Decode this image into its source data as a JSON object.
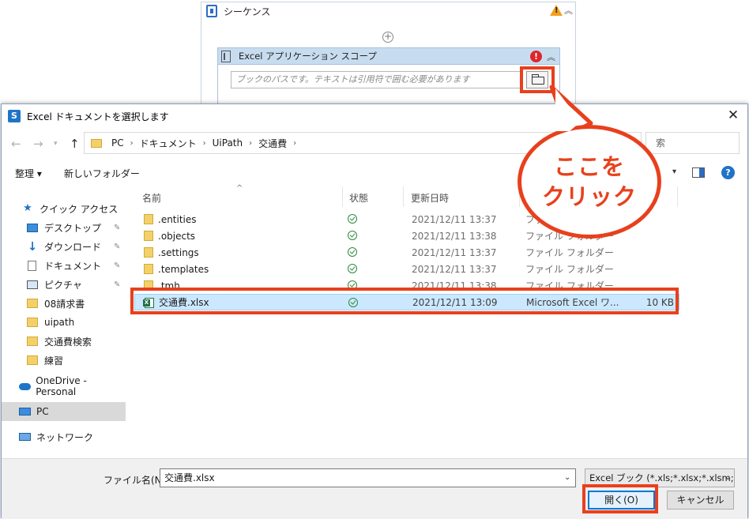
{
  "sequence": {
    "title": "シーケンス",
    "warning_icon": "warning-icon",
    "collapse_icon": "chevron-up-double-icon"
  },
  "scope": {
    "title": "Excel アプリケーション スコープ",
    "placeholder": "ブックのパスです。テキストは引用符で囲む必要があります",
    "error_icon": "error-icon",
    "browse_icon": "folder-icon"
  },
  "dialog": {
    "title": "Excel ドキュメントを選択します",
    "breadcrumbs": [
      "PC",
      "ドキュメント",
      "UiPath",
      "交通費"
    ],
    "search_placeholder": "索",
    "toolbar": {
      "organize": "整理 ▾",
      "new_folder": "新しいフォルダー"
    },
    "nav": [
      {
        "label": "クイック アクセス",
        "icon": "star-icon"
      },
      {
        "label": "デスクトップ",
        "icon": "desktop-icon",
        "pinned": true
      },
      {
        "label": "ダウンロード",
        "icon": "download-icon",
        "pinned": true
      },
      {
        "label": "ドキュメント",
        "icon": "documents-icon",
        "pinned": true
      },
      {
        "label": "ピクチャ",
        "icon": "pictures-icon",
        "pinned": true
      },
      {
        "label": "08請求書",
        "icon": "folder-icon"
      },
      {
        "label": "uipath",
        "icon": "folder-icon"
      },
      {
        "label": "交通費検索",
        "icon": "folder-icon"
      },
      {
        "label": "練習",
        "icon": "folder-icon"
      },
      {
        "label": "OneDrive - Personal",
        "icon": "cloud-icon"
      },
      {
        "label": "PC",
        "icon": "pc-icon"
      },
      {
        "label": "ネットワーク",
        "icon": "network-icon"
      }
    ],
    "columns": {
      "name": "名前",
      "status": "状態",
      "modified": "更新日時"
    },
    "files": [
      {
        "name": ".entities",
        "date": "2021/12/11 13:37",
        "type": "ファイル フォルダー",
        "size": ""
      },
      {
        "name": ".objects",
        "date": "2021/12/11 13:38",
        "type": "ファイル フォルダー",
        "size": ""
      },
      {
        "name": ".settings",
        "date": "2021/12/11 13:37",
        "type": "ファイル フォルダー",
        "size": ""
      },
      {
        "name": ".templates",
        "date": "2021/12/11 13:37",
        "type": "ファイル フォルダー",
        "size": ""
      },
      {
        "name": ".tmh",
        "date": "2021/12/11 13:38",
        "type": "ファイル フォルダー",
        "size": ""
      },
      {
        "name": "交通費.xlsx",
        "date": "2021/12/11 13:09",
        "type": "Microsoft Excel ワ...",
        "size": "10 KB"
      }
    ],
    "filename_label": "ファイル名(N):",
    "filename_value": "交通費.xlsx",
    "filetype_value": "Excel ブック (*.xls;*.xlsx;*.xlsm;*.x",
    "open_label": "開く(O)",
    "cancel_label": "キャンセル"
  },
  "callout": {
    "line1": "ここを",
    "line2": "クリック"
  },
  "colors": {
    "annotation": "#e8401c",
    "selection": "#cce8ff",
    "accent": "#0078d7"
  }
}
